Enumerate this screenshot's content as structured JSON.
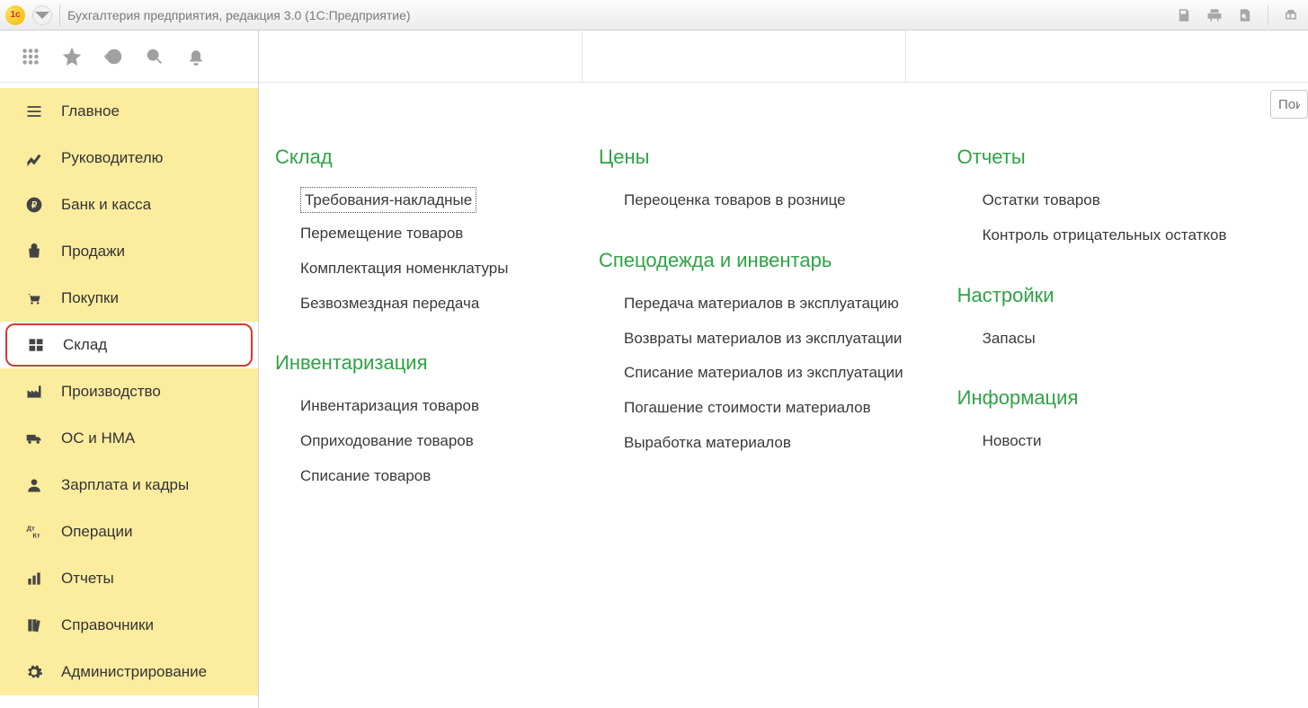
{
  "window": {
    "logo_text": "1с",
    "title": "Бухгалтерия предприятия, редакция 3.0  (1С:Предприятие)"
  },
  "search": {
    "placeholder": "Поиск"
  },
  "sidebar": {
    "items": [
      {
        "id": "main",
        "label": "Главное"
      },
      {
        "id": "manager",
        "label": "Руководителю"
      },
      {
        "id": "bank",
        "label": "Банк и касса"
      },
      {
        "id": "sales",
        "label": "Продажи"
      },
      {
        "id": "purchases",
        "label": "Покупки"
      },
      {
        "id": "warehouse",
        "label": "Склад"
      },
      {
        "id": "production",
        "label": "Производство"
      },
      {
        "id": "assets",
        "label": "ОС и НМА"
      },
      {
        "id": "hr",
        "label": "Зарплата и кадры"
      },
      {
        "id": "operations",
        "label": "Операции"
      },
      {
        "id": "reports",
        "label": "Отчеты"
      },
      {
        "id": "catalogs",
        "label": "Справочники"
      },
      {
        "id": "admin",
        "label": "Администрирование"
      }
    ]
  },
  "sections": {
    "col1": [
      {
        "title": "Склад",
        "links": [
          "Требования-накладные",
          "Перемещение товаров",
          "Комплектация номенклатуры",
          "Безвозмездная передача"
        ],
        "focused_index": 0
      },
      {
        "title": "Инвентаризация",
        "links": [
          "Инвентаризация товаров",
          "Оприходование товаров",
          "Списание товаров"
        ]
      }
    ],
    "col2": [
      {
        "title": "Цены",
        "links": [
          "Переоценка товаров в рознице"
        ]
      },
      {
        "title": "Спецодежда и инвентарь",
        "links": [
          "Передача материалов в эксплуатацию",
          "Возвраты материалов из эксплуатации",
          "Списание материалов из эксплуатации",
          "Погашение стоимости материалов",
          "Выработка материалов"
        ]
      }
    ],
    "col3": [
      {
        "title": "Отчеты",
        "links": [
          "Остатки товаров",
          "Контроль отрицательных остатков"
        ]
      },
      {
        "title": "Настройки",
        "links": [
          "Запасы"
        ]
      },
      {
        "title": "Информация",
        "links": [
          "Новости"
        ]
      }
    ]
  }
}
